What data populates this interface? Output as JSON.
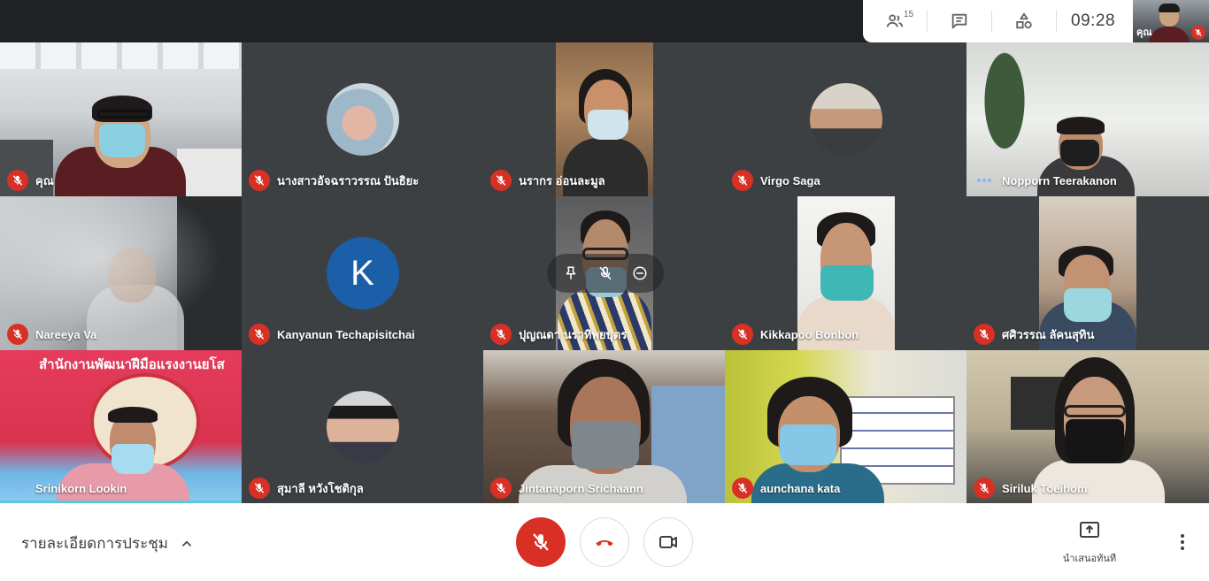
{
  "header": {
    "participants_count": "15",
    "clock": "09:28",
    "self_view_label": "คุณ",
    "icons": [
      "people-icon",
      "chat-icon",
      "activities-icon"
    ]
  },
  "participants": [
    {
      "name": "คุณ",
      "status": "muted",
      "kind": "video"
    },
    {
      "name": "นางสาวอัจฉราวรรณ ปันธิยะ",
      "status": "muted",
      "kind": "photo"
    },
    {
      "name": "นรากร อ่อนละมูล",
      "status": "muted",
      "kind": "video"
    },
    {
      "name": "Virgo Saga",
      "status": "muted",
      "kind": "photo"
    },
    {
      "name": "Nopporn Teerakanon",
      "status": "speaking",
      "kind": "video"
    },
    {
      "name": "Nareeya Va",
      "status": "muted",
      "kind": "video"
    },
    {
      "name": "Kanyanun Techapisitchai",
      "status": "muted",
      "kind": "initial",
      "initial": "K"
    },
    {
      "name": "ปุญณดา นราทิพยบุตร",
      "status": "muted",
      "kind": "video"
    },
    {
      "name": "Kikkapoo Bonbon",
      "status": "muted",
      "kind": "video"
    },
    {
      "name": "ศศิวรรณ ลัคนสุทิน",
      "status": "muted",
      "kind": "video"
    },
    {
      "name": "Srinikorn Lookin",
      "status": "speaking",
      "kind": "video"
    },
    {
      "name": "สุมาลี หวังโชติกุล",
      "status": "muted",
      "kind": "photo"
    },
    {
      "name": "Jintanaporn Srichaann",
      "status": "muted",
      "kind": "video"
    },
    {
      "name": "aunchana kata",
      "status": "muted",
      "kind": "video"
    },
    {
      "name": "Siriluk Toeihom",
      "status": "muted",
      "kind": "video"
    }
  ],
  "banner_text": "สำนักงานพัฒนาฝีมือแรงงานยโส",
  "footer": {
    "meeting_details_label": "รายละเอียดการประชุม",
    "present_label": "นำเสนอทันที"
  },
  "colors": {
    "muted_red": "#d93025",
    "speaking_blue": "#8ab4f8",
    "avatar_blue": "#1a73e8",
    "background": "#202124"
  }
}
